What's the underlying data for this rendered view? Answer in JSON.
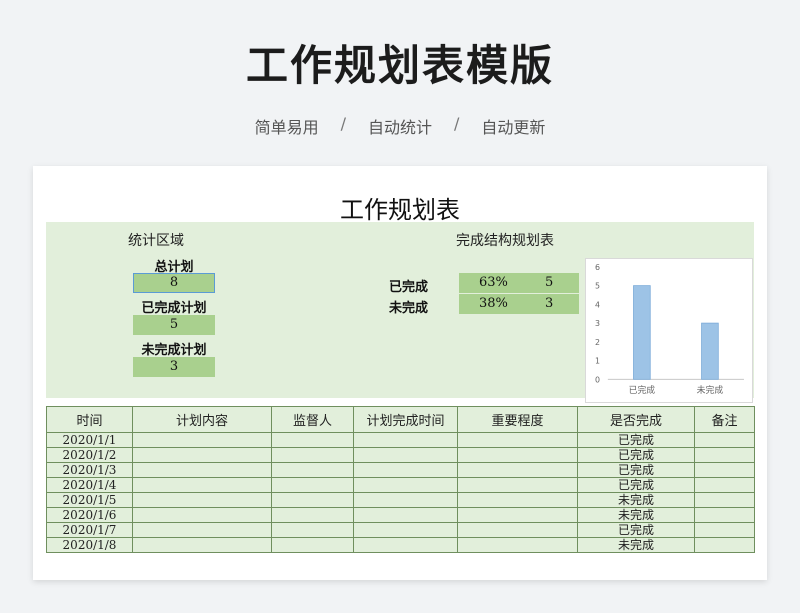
{
  "header": {
    "title": "工作规划表模版",
    "taglines": [
      "简单易用",
      "自动统计",
      "自动更新"
    ],
    "separator": "/"
  },
  "sheet": {
    "title": "工作规划表",
    "stats_heading": "统计区域",
    "structure_heading": "完成结构规划表",
    "stats": [
      {
        "label": "总计划",
        "value": "8"
      },
      {
        "label": "已完成计划",
        "value": "5"
      },
      {
        "label": "未完成计划",
        "value": "3"
      }
    ],
    "structure": [
      {
        "label": "已完成",
        "percent": "63%",
        "count": "5"
      },
      {
        "label": "未完成",
        "percent": "38%",
        "count": "3"
      }
    ]
  },
  "chart_data": {
    "type": "bar",
    "categories": [
      "已完成",
      "未完成"
    ],
    "values": [
      5,
      3
    ],
    "ylim": [
      0,
      6
    ],
    "yticks": [
      0,
      1,
      2,
      3,
      4,
      5,
      6
    ],
    "grid": false,
    "color": "#9dc3e6"
  },
  "table": {
    "columns": [
      "时间",
      "计划内容",
      "监督人",
      "计划完成时间",
      "重要程度",
      "是否完成",
      "备注"
    ],
    "rows": [
      {
        "date": "2020/1/1",
        "status": "已完成"
      },
      {
        "date": "2020/1/2",
        "status": "已完成"
      },
      {
        "date": "2020/1/3",
        "status": "已完成"
      },
      {
        "date": "2020/1/4",
        "status": "已完成"
      },
      {
        "date": "2020/1/5",
        "status": "未完成"
      },
      {
        "date": "2020/1/6",
        "status": "未完成"
      },
      {
        "date": "2020/1/7",
        "status": "已完成"
      },
      {
        "date": "2020/1/8",
        "status": "未完成"
      }
    ]
  }
}
